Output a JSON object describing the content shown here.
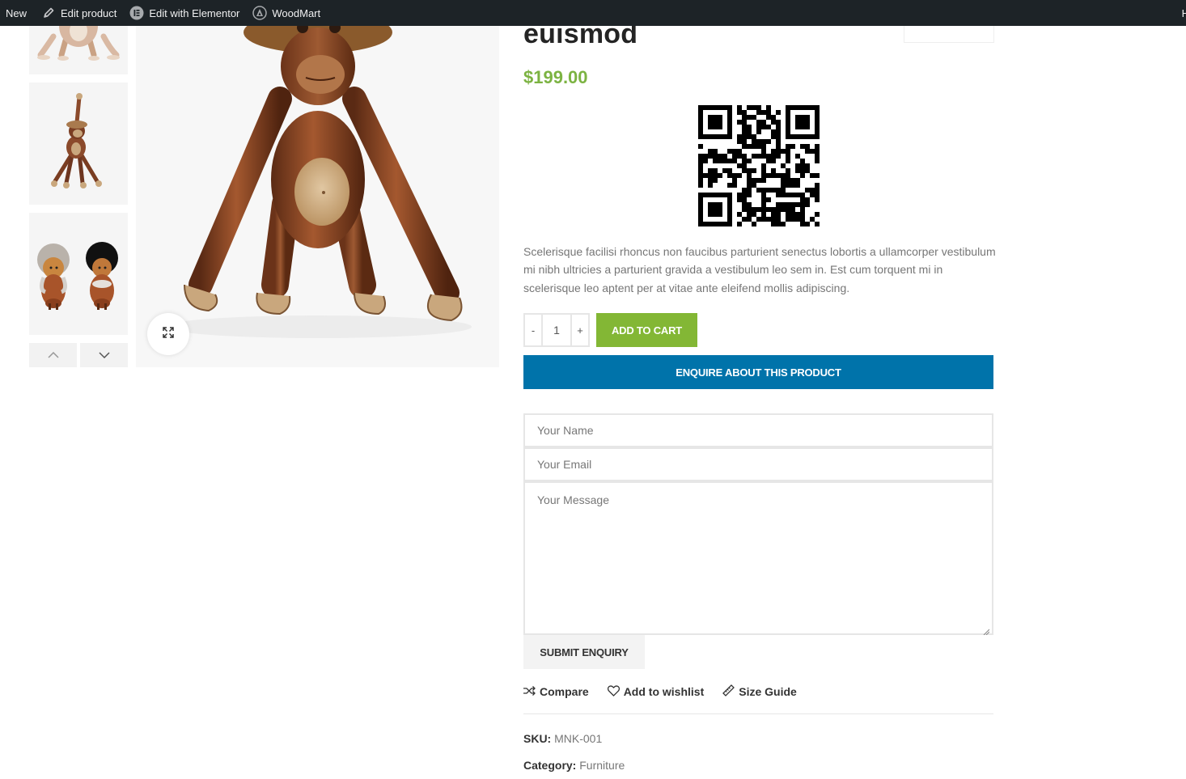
{
  "admin_bar": {
    "new_label": "New",
    "edit_product_label": "Edit product",
    "edit_elementor_label": "Edit with Elementor",
    "woodmart_label": "WoodMart",
    "right_label": "H"
  },
  "product": {
    "title": "euismod",
    "price": "$199.00",
    "description": "Scelerisque facilisi rhoncus non faucibus parturient senectus lobortis a ullamcorper vestibulum mi nibh ultricies a parturient gravida a vestibulum leo sem in. Est cum torquent mi in scelerisque leo aptent per at vitae ante eleifend mollis adipiscing.",
    "quantity": "1",
    "qty_minus": "-",
    "qty_plus": "+",
    "add_to_cart_label": "ADD TO CART",
    "enquire_label": "ENQUIRE ABOUT THIS PRODUCT"
  },
  "enquiry_form": {
    "name_placeholder": "Your Name",
    "email_placeholder": "Your Email",
    "message_placeholder": "Your Message",
    "submit_label": "SUBMIT ENQUIRY"
  },
  "actions": {
    "compare_label": "Compare",
    "wishlist_label": "Add to wishlist",
    "size_guide_label": "Size Guide"
  },
  "meta": {
    "sku_label": "SKU:",
    "sku_value": "MNK-001",
    "category_label": "Category:",
    "category_value": "Furniture"
  },
  "colors": {
    "price_green": "#7cb342",
    "cart_green": "#83b735",
    "enquire_blue": "#0073aa",
    "admin_bar": "#1d2327"
  },
  "icons": [
    "pencil-icon",
    "elementor-icon",
    "woodmart-icon",
    "zoom-expand-icon",
    "chevron-up-icon",
    "chevron-down-icon",
    "compare-icon",
    "heart-icon",
    "ruler-icon",
    "qr-code-icon"
  ]
}
